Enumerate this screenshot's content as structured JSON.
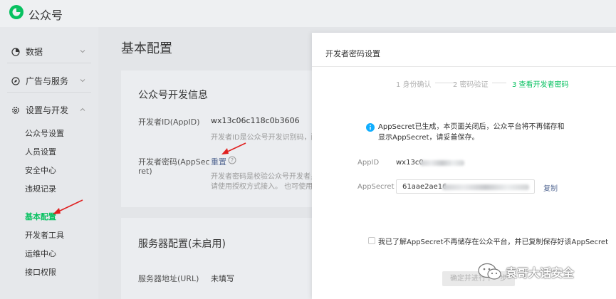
{
  "header": {
    "brand": "公众号"
  },
  "sidebar": {
    "groups": [
      {
        "label": "数据"
      },
      {
        "label": "广告与服务"
      },
      {
        "label": "设置与开发"
      }
    ],
    "items": [
      {
        "label": "公众号设置"
      },
      {
        "label": "人员设置"
      },
      {
        "label": "安全中心"
      },
      {
        "label": "违规记录"
      },
      {
        "label": "基本配置"
      },
      {
        "label": "开发者工具"
      },
      {
        "label": "运维中心"
      },
      {
        "label": "接口权限"
      }
    ]
  },
  "main": {
    "page_title": "基本配置",
    "dev_info": {
      "title": "公众号开发信息",
      "appid_label": "开发者ID(AppID)",
      "appid_value": "wx13c06c118c0b3606",
      "appid_hint": "开发者ID是公众号开发识别码，配合",
      "secret_label_1": "开发者密码(AppSec",
      "secret_label_2": "ret)",
      "secret_reset": "重置",
      "secret_hint_1": "开发者密码是校验公众号开发者身份",
      "secret_hint_2": "请使用授权方式接入。 也可使用微"
    },
    "server": {
      "title": "服务器配置(未启用)",
      "url_label": "服务器地址(URL)",
      "url_value": "未填写"
    }
  },
  "dialog": {
    "title": "开发者密码设置",
    "steps": [
      "1 身份确认",
      "2 密码验证",
      "3 查看开发者密码"
    ],
    "info": "AppSecret已生成，本页面关闭后，公众平台将不再储存和显示AppSecret，请妥善保存。",
    "appid_label": "AppID",
    "appid_value": "wx13c0",
    "secret_label": "AppSecret",
    "secret_value": "61aae2ae16",
    "copy": "复制",
    "checkbox_label": "我已了解AppSecret不再储存在公众平台，并已复制保存好该AppSecret",
    "confirm": "确定并进行下一步"
  },
  "watermark": {
    "text": "袁哥大话安全"
  },
  "colors": {
    "accent": "#07c160",
    "link": "#576b95",
    "arrow": "#e02020"
  }
}
